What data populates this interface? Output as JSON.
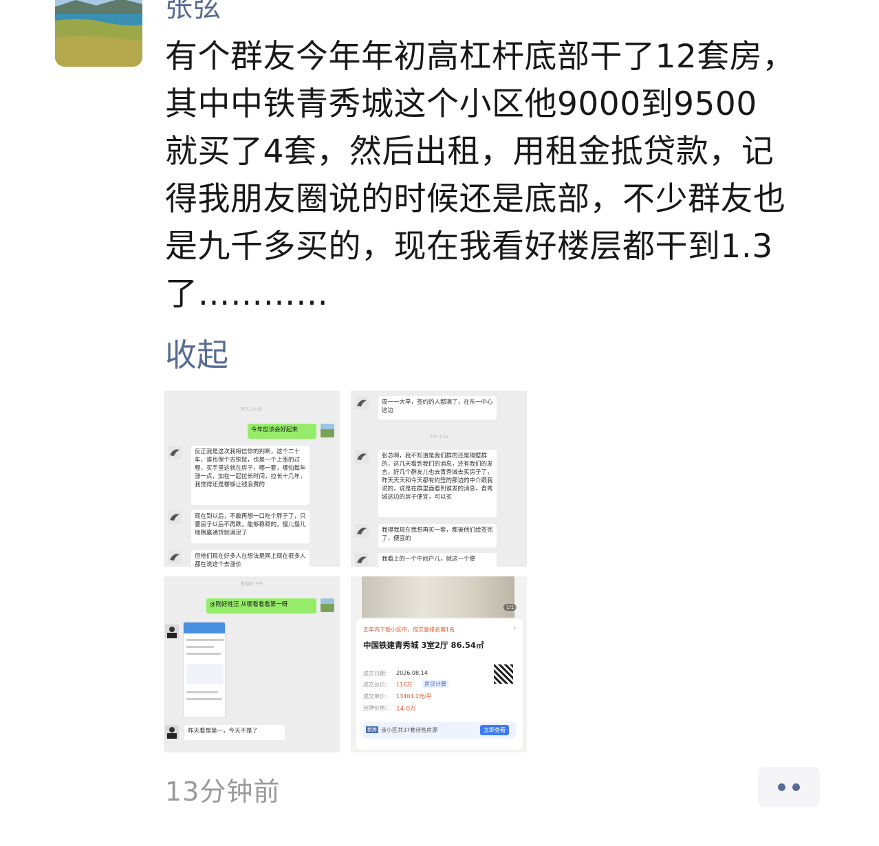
{
  "post": {
    "author": "张弦",
    "text": "有个群友今年年初高杠杆底部干了12套房，\n其中中铁青秀城这个小区他9000到9500\n就买了4套，然后出租，用租金抵贷款，记\n得我朋友圈说的时候还是底部，不少群友也\n是九千多买的，现在我看好楼层都干到1.3\n了…………",
    "collapse_label": "收起",
    "timestamp": "13分钟前"
  },
  "images": {
    "chat1": {
      "time": "昨天 20:05",
      "msg_out": "今年应该会好起来",
      "msg1": "反正我是这次我相信你的判断，这个二十年，谁也保个吉铜鼠，也是一个上涨的过程，买手里这就在房子，哪一套，哪怕每年涨一点，加在一起拉长时间，拉长十几年，我觉得还是楼够让钱浪费的",
      "msg2": "现在到以后，不敢再想一口吃个胖子了，只要房子以后不再跌，能够稳稳的，慢儿慢儿地跑赢通货就满足了",
      "msg3": "但他们现在好多人在想法是网上现在很多人都在说这个去涨价"
    },
    "chat2": {
      "msg1": "周一一大早，签约的人都满了，在东一中心这边",
      "time": "下午 4:16",
      "msg2": "张总啊，我不知道是我们群的还是隔壁群的，这几天看到我们的消息，还有我们的发言，好几个群友儿也去青秀城去买房子了，昨天天天和今天都有约签的那边的中介跟我说的，说是在群里面看到谁发的消息，青秀城这边的房子便宜，可以买",
      "msg3": "我得我现在我想再买一套，都被他们给签完了，便宜的",
      "msg4": "我看上的一个中间户儿，就这一个便"
    },
    "chat3": {
      "time": "星期四 下午",
      "msg_out": "@刚好姓汪 从哪看看看第一呀",
      "msg_in": "昨天看是第一，今天不是了"
    },
    "listing": {
      "counter": "1/1",
      "tag": "五年内下载小区中，成交量排名第1名",
      "title": "中国铁建青秀城 3室2厅 86.54㎡",
      "date_label": "成交日期：",
      "date": "2026.08.14",
      "total_label": "成交总价：",
      "total": "116万",
      "calc_label": "房贷计算",
      "unit_label": "成交单价：",
      "unit": "13404.2元/平",
      "list_label": "挂牌价格：",
      "list_price": "14.0万",
      "footer": "该小区共37套待售房源",
      "footer_tag": "新房",
      "button": "立即查看"
    }
  },
  "colors": {
    "link": "#576b95",
    "timestamp": "#9a9a9a",
    "wechat_green": "#95ec69",
    "price_red": "#e4572e"
  }
}
